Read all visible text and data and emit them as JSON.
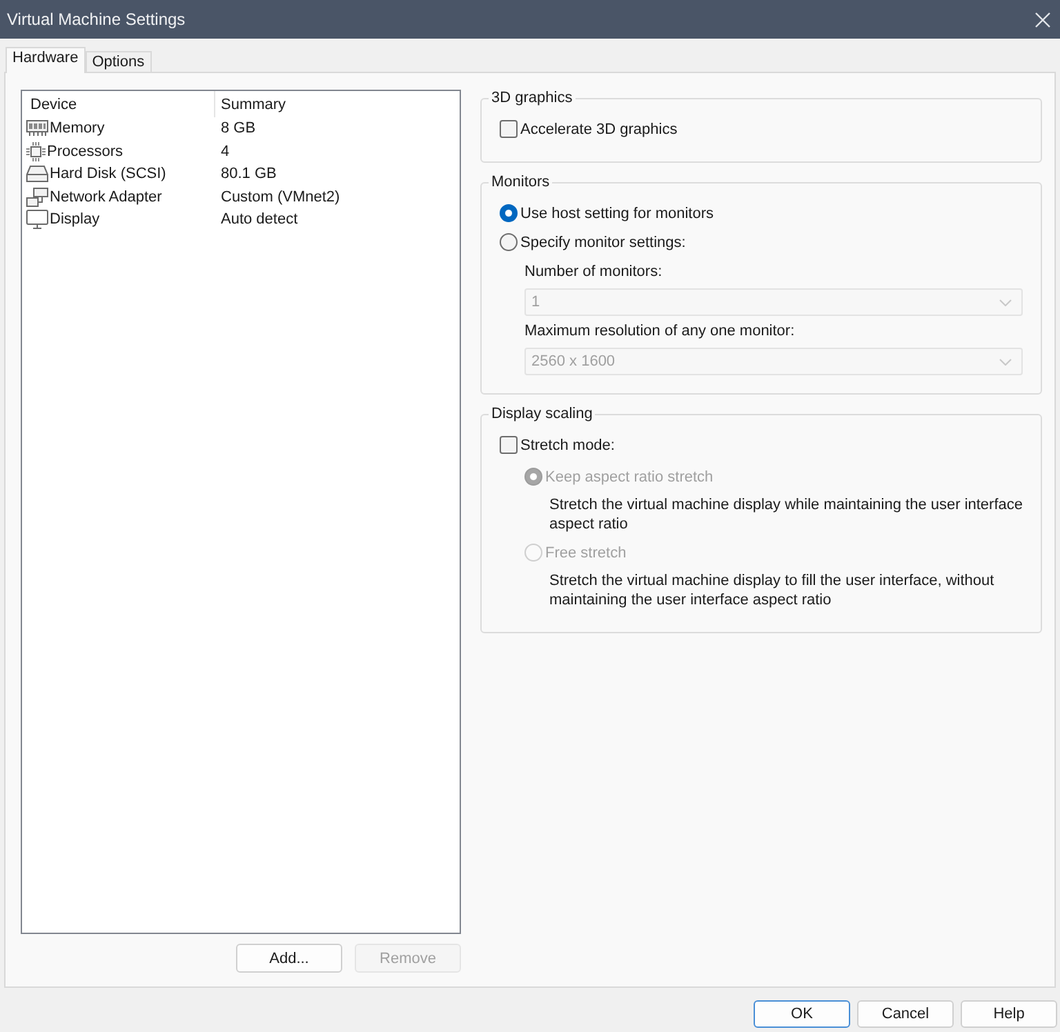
{
  "window": {
    "title": "Virtual Machine Settings"
  },
  "tabs": [
    {
      "label": "Hardware",
      "selected": true
    },
    {
      "label": "Options",
      "selected": false
    }
  ],
  "device_list": {
    "columns": [
      "Device",
      "Summary"
    ],
    "rows": [
      {
        "kind": "memory",
        "device": "Memory",
        "summary": "8 GB",
        "selected": false
      },
      {
        "kind": "processor",
        "device": "Processors",
        "summary": "4",
        "selected": false
      },
      {
        "kind": "disk",
        "device": "Hard Disk (SCSI)",
        "summary": "80.1 GB",
        "selected": false
      },
      {
        "kind": "network",
        "device": "Network Adapter",
        "summary": "Custom (VMnet2)",
        "selected": false
      },
      {
        "kind": "display",
        "device": "Display",
        "summary": "Auto detect",
        "selected": false
      }
    ]
  },
  "list_buttons": [
    {
      "label": "Add...",
      "disabled": false
    },
    {
      "label": "Remove",
      "disabled": true
    }
  ],
  "groups": [
    {
      "title": "3D graphics",
      "items": [
        {
          "kind": "checkbox",
          "label": "Accelerate 3D graphics",
          "checked": false,
          "disabled": false
        }
      ]
    },
    {
      "title": "Monitors",
      "items": [
        {
          "kind": "radio",
          "label": "Use host setting for monitors",
          "selected": true,
          "disabled": false
        },
        {
          "kind": "radio",
          "label": "Specify monitor settings:",
          "selected": false,
          "disabled": false,
          "children": [
            {
              "kind": "select",
              "label": "Number of monitors:",
              "value": "1",
              "disabled": true
            },
            {
              "kind": "select",
              "label": "Maximum resolution of any one monitor:",
              "value": "2560 x 1600",
              "disabled": true
            }
          ]
        }
      ]
    },
    {
      "title": "Display scaling",
      "items": [
        {
          "kind": "checkbox",
          "label": "Stretch mode:",
          "checked": false,
          "disabled": false,
          "children": [
            {
              "kind": "radio",
              "label": "Keep aspect ratio stretch",
              "selected": true,
              "disabled": true,
              "description": "Stretch the virtual machine display while maintaining the user interface aspect ratio"
            },
            {
              "kind": "radio",
              "label": "Free stretch",
              "selected": false,
              "disabled": true,
              "description": "Stretch the virtual machine display to fill the user interface, without maintaining the user interface aspect ratio"
            }
          ]
        }
      ]
    }
  ],
  "dialog_buttons": [
    {
      "label": "OK",
      "default": true
    },
    {
      "label": "Cancel",
      "default": false
    },
    {
      "label": "Help",
      "default": false
    }
  ]
}
